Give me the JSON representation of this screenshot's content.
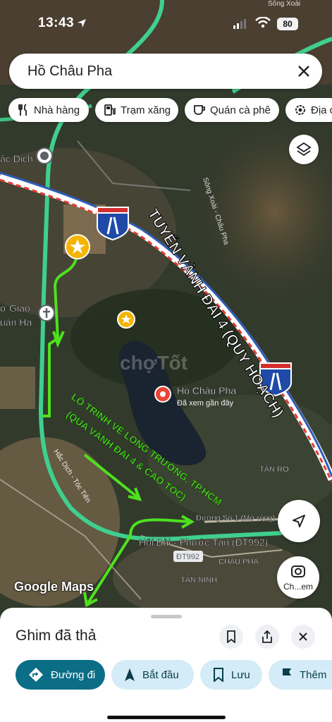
{
  "status_bar": {
    "time": "13:43",
    "battery": "80"
  },
  "search": {
    "query": "Hồ Châu Pha"
  },
  "chips": [
    {
      "label": "Nhà hàng",
      "icon": "fork-knife-icon"
    },
    {
      "label": "Trạm xăng",
      "icon": "gas-station-icon"
    },
    {
      "label": "Quán cà phê",
      "icon": "coffee-cup-icon"
    },
    {
      "label": "Địa c",
      "icon": "gear-place-icon"
    }
  ],
  "map": {
    "top_label": "Sông Xoài",
    "place_labels": {
      "hac_dich": "ắc Dịch",
      "song_xoai_chau_pha": "Sông Xoài - Châu Pha",
      "giao_xu": "ờ Giáo",
      "xuan_ha": "uân Hà",
      "watermark": "chợTốt",
      "lake_name": "Hồ Châu Pha",
      "lake_sub": "Đã xem gần đây",
      "tan_ro": "TÂN RO",
      "hac_dich_toc_tien": "Hắc Dịch - Tóc Tiên",
      "duong_so_1": "Đường Số 1 (Mở rộng)",
      "hoi_bai": "Hội Bài - Phước Tân (ĐT992)",
      "dt992": "ĐT992",
      "chau_pha": "CHÂU PHA",
      "tan_ninh": "TÂN NINH"
    },
    "overlay_ring": "TUYẾN VÀNH ĐAI 4 (QUY HOẠCH)",
    "overlay_route_line1": "LỘ TRÌNH VỀ LONG TRƯỜNG, TP.HCM",
    "overlay_route_line2": "(QUA VÀNH ĐAI 4 & CAO TỐC)",
    "lens_label": "Ch...em",
    "attribution": "Google Maps"
  },
  "sheet": {
    "title": "Ghim đã thả",
    "actions": [
      {
        "label": "Đường đi",
        "icon": "directions-icon"
      },
      {
        "label": "Bắt đầu",
        "icon": "navigation-arrow-icon"
      },
      {
        "label": "Lưu",
        "icon": "bookmark-icon"
      },
      {
        "label": "Thêm",
        "icon": "flag-icon"
      }
    ]
  },
  "colors": {
    "road_green": "#3fcf8e",
    "ring_red": "#e53935",
    "ring_blue": "#2f5bb7",
    "route_arrow": "#4ee11e",
    "overlay_text": "#4ee11e",
    "directions_button": "#0b6d86",
    "action_chip": "#d3ecf7"
  }
}
